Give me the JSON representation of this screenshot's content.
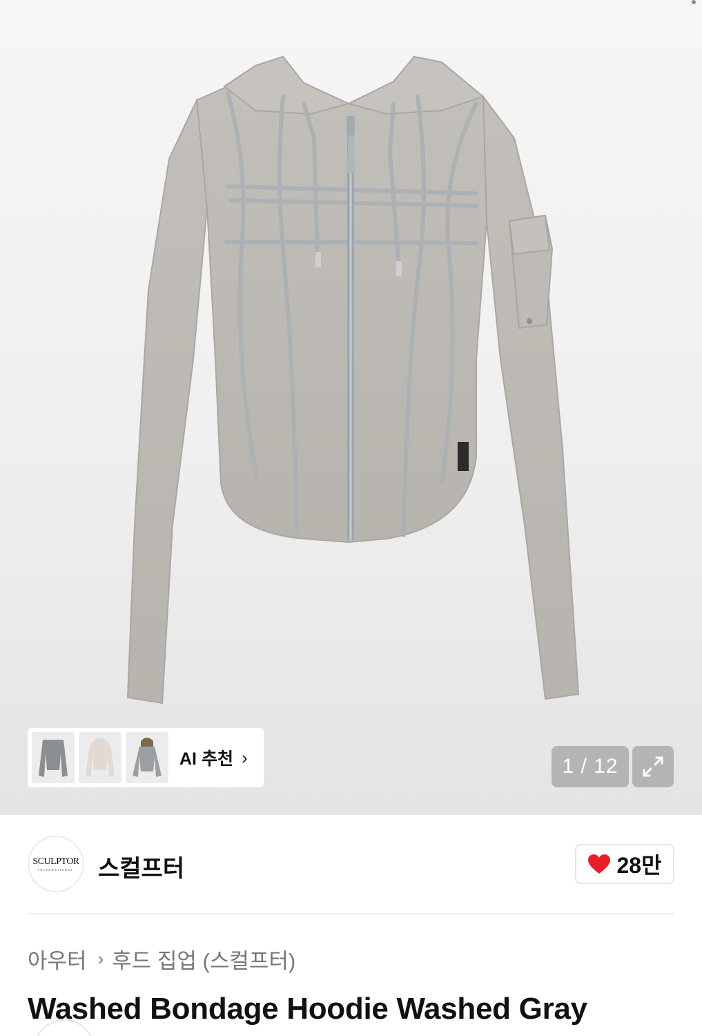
{
  "gallery": {
    "ai_recommend_label": "AI 추천",
    "ai_recommend_chevron": "›",
    "ai_thumbnails": [
      "gray-zip-hoodie-thumb",
      "light-hoodie-thumb",
      "beige-hoodie-thumb"
    ],
    "page_counter": "1 / 12",
    "expand_icon": "expand-icon"
  },
  "brand": {
    "logo_text": "SCULPTOR",
    "logo_subtext": "INTERNATIONAL",
    "name": "스컬프터",
    "likes": "28만",
    "like_icon": "heart-icon",
    "like_color": "#e8202a"
  },
  "breadcrumb": {
    "category": "아우터",
    "separator": "›",
    "subcategory": "후드 집업 (스컬프터)"
  },
  "product": {
    "title": "Washed Bondage Hoodie Washed Gray",
    "color": "#bcb8b3"
  }
}
